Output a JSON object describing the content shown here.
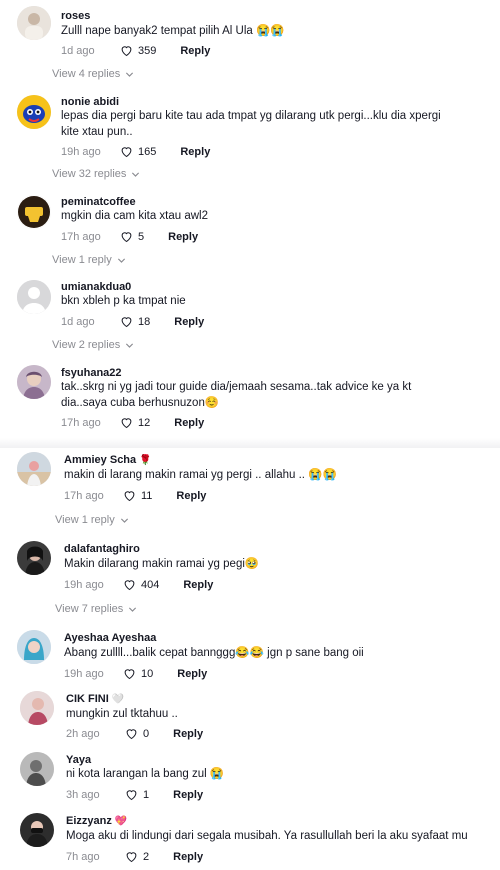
{
  "comments": [
    {
      "user": "roses",
      "text": "Zulll nape banyak2 tempat pilih Al Ula 😭😭",
      "time": "1d ago",
      "likes": "359",
      "reply": "Reply",
      "view_replies": "View 4 replies",
      "avatar": "photo-avatar"
    },
    {
      "user": "nonie abidi",
      "text": "lepas dia pergi baru kite tau ada tmpat yg dilarang utk pergi...klu dia xpergi kite xtau pun..",
      "time": "19h ago",
      "likes": "165",
      "reply": "Reply",
      "view_replies": "View 32 replies",
      "avatar": "blue-cartoon-avatar"
    },
    {
      "user": "peminatcoffee",
      "text": "mgkin dia cam kita xtau awl2",
      "time": "17h ago",
      "likes": "5",
      "reply": "Reply",
      "view_replies": "View 1 reply",
      "avatar": "coffee-logo-avatar"
    },
    {
      "user": "umianakdua0",
      "text": "bkn xbleh p ka tmpat nie",
      "time": "1d ago",
      "likes": "18",
      "reply": "Reply",
      "view_replies": "View 2 replies",
      "avatar": "default-avatar"
    },
    {
      "user": "fsyuhana22",
      "text": "tak..skrg ni yg jadi tour guide dia/jemaah sesama..tak advice ke ya kt dia..saya cuba berhusnuzon☺️",
      "time": "17h ago",
      "likes": "12",
      "reply": "Reply",
      "view_replies": "",
      "avatar": "photo-avatar"
    },
    {
      "user": "Ammiey Scha",
      "badge": "🌹",
      "text": "makin di larang makin ramai yg pergi .. allahu .. 😭😭",
      "time": "17h ago",
      "likes": "11",
      "reply": "Reply",
      "view_replies": "View 1 reply",
      "avatar": "photo-avatar"
    },
    {
      "user": "dalafantaghiro",
      "text": "Makin dilarang makin ramai yg pegi🥹",
      "time": "19h ago",
      "likes": "404",
      "reply": "Reply",
      "view_replies": "View 7 replies",
      "avatar": "photo-avatar"
    },
    {
      "user": "Ayeshaa Ayeshaa",
      "text": "Abang zullll...balik cepat bannggg😂😂 jgn p sane bang oii",
      "time": "19h ago",
      "likes": "10",
      "reply": "Reply",
      "view_replies": "",
      "avatar": "photo-avatar"
    },
    {
      "user": "CIK FINI",
      "badge": "🤍",
      "text": "mungkin zul tktahuu ..",
      "time": "2h ago",
      "likes": "0",
      "reply": "Reply",
      "view_replies": "",
      "avatar": "photo-avatar"
    },
    {
      "user": "Yaya",
      "text": "ni kota larangan la bang zul 😭",
      "time": "3h ago",
      "likes": "1",
      "reply": "Reply",
      "view_replies": "",
      "avatar": "photo-avatar"
    },
    {
      "user": "Eizzyanz",
      "badge": "💖",
      "text": "Moga aku di lindungi dari segala musibah. Ya rasullullah beri la aku syafaat mu",
      "time": "7h ago",
      "likes": "2",
      "reply": "Reply",
      "view_replies": "",
      "avatar": "photo-avatar"
    }
  ]
}
